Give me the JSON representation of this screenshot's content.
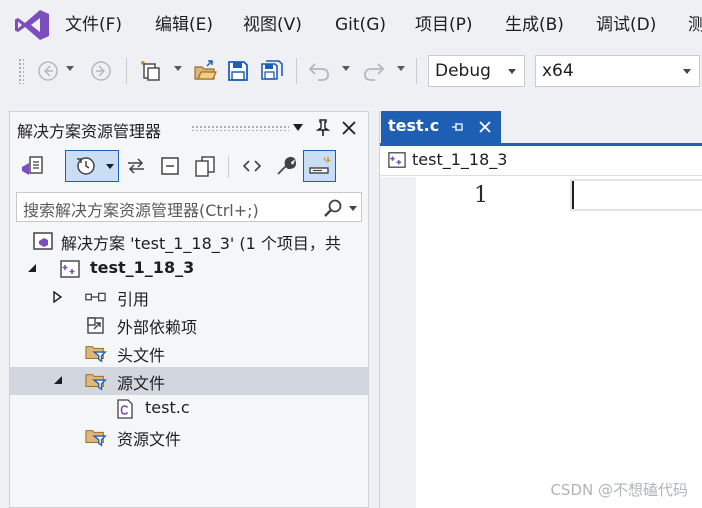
{
  "menu": {
    "items": [
      "文件(F)",
      "编辑(E)",
      "视图(V)",
      "Git(G)",
      "项目(P)",
      "生成(B)",
      "调试(D)",
      "测"
    ]
  },
  "toolbar": {
    "configuration": "Debug",
    "platform": "x64"
  },
  "solution_explorer": {
    "title": "解决方案资源管理器",
    "search_placeholder": "搜索解决方案资源管理器(Ctrl+;)",
    "tree": {
      "solution": "解决方案 'test_1_18_3' (1 个项目，共",
      "project": "test_1_18_3",
      "references": "引用",
      "external_deps": "外部依赖项",
      "header_files": "头文件",
      "source_files": "源文件",
      "source_file_item": "test.c",
      "resource_files": "资源文件"
    }
  },
  "editor": {
    "tab_label": "test.c",
    "nav_project": "test_1_18_3",
    "line_number": "1"
  },
  "watermark": "CSDN @不想磕代码",
  "colors": {
    "accent": "#1f5fb3",
    "selected_row": "#d2d6de",
    "vs_purple": "#7c4dbd"
  }
}
